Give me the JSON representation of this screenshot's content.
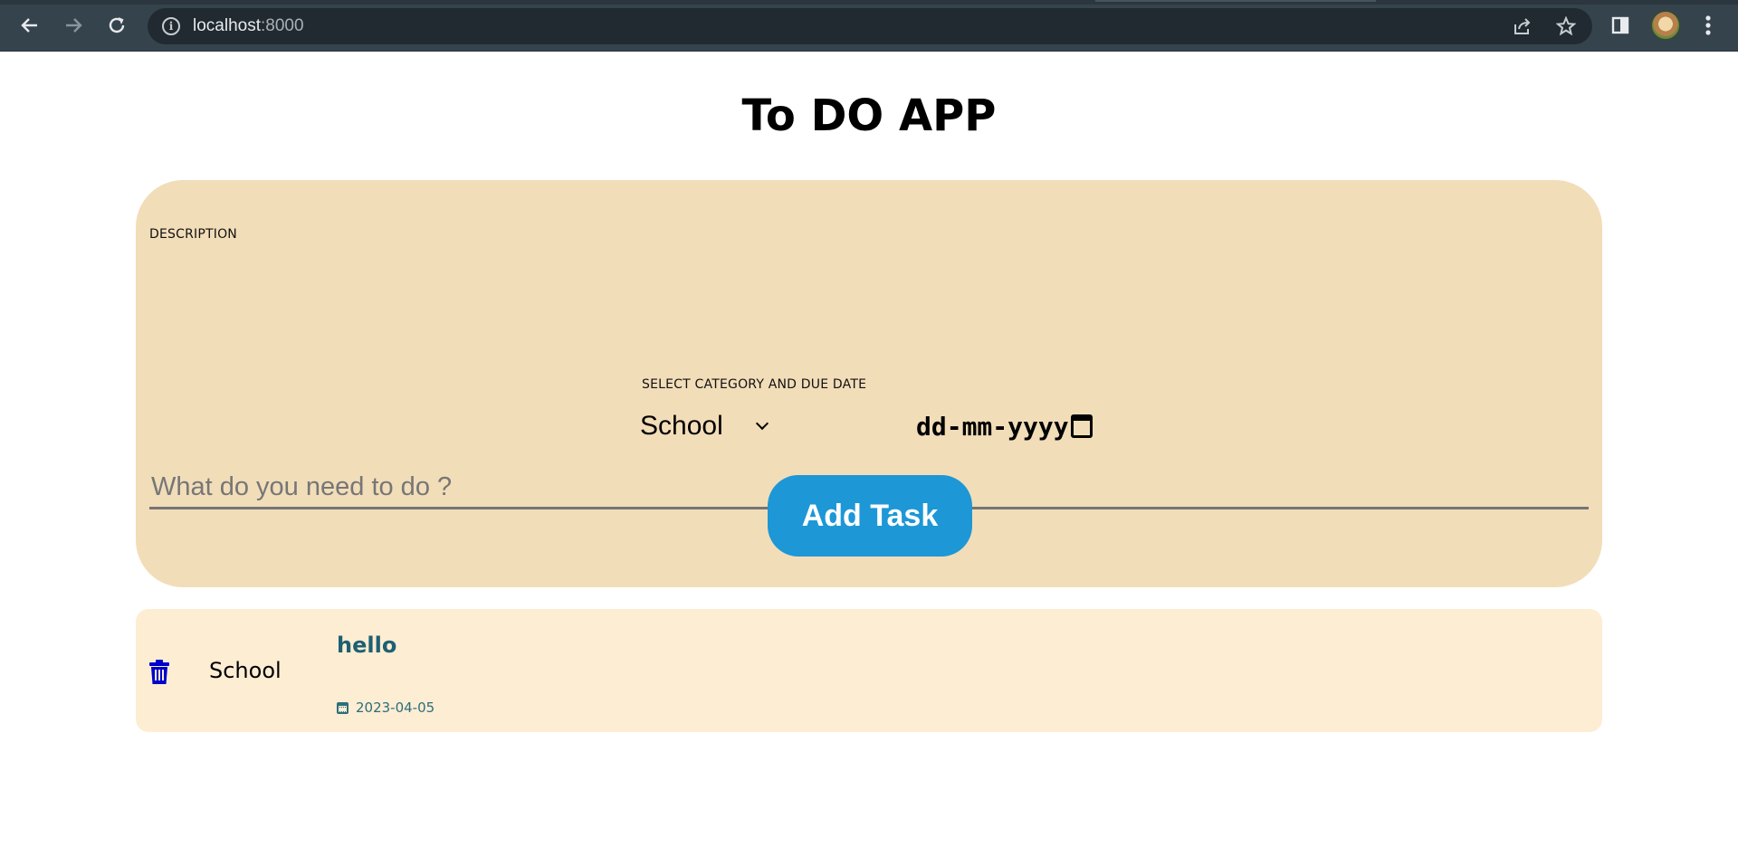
{
  "browser": {
    "url_host": "localhost",
    "url_port": ":8000",
    "icons": [
      "back-icon",
      "forward-icon",
      "reload-icon",
      "info-icon",
      "share-icon",
      "star-icon",
      "sidebar-icon",
      "avatar",
      "menu-icon"
    ]
  },
  "app": {
    "title": "To DO APP"
  },
  "form": {
    "description_label": "DESCRIPTION",
    "description_placeholder": "What do you need to do ?",
    "description_value": "",
    "category_date_label": "SELECT CATEGORY AND DUE DATE",
    "category_selected": "School",
    "date_placeholder": "dd-mm-yyyy",
    "submit_label": "Add Task"
  },
  "tasks": [
    {
      "category": "School",
      "title": "hello",
      "due_date": "2023-04-05"
    }
  ],
  "colors": {
    "form_card_bg": "#f2ddb9",
    "task_row_bg": "#fdedd3",
    "button_bg": "#1d97d6",
    "task_title": "#1f5f73",
    "trash_icon": "#0000cc"
  }
}
